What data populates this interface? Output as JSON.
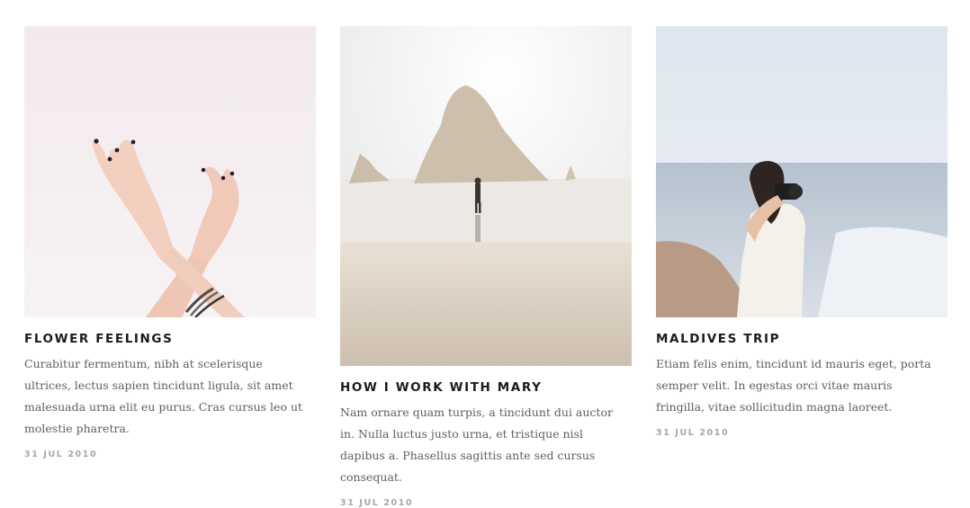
{
  "posts": [
    {
      "title": "Flower Feelings",
      "excerpt": "Curabitur fermentum, nibh at scelerisque ultrices, lectus sapien tincidunt ligula, sit amet malesuada urna elit eu purus. Cras cursus leo ut molestie pharetra.",
      "date": "31 Jul 2010",
      "image": "crossed-hands-photo"
    },
    {
      "title": "How I Work With Mary",
      "excerpt": "Nam ornare quam turpis, a tincidunt dui auctor in. Nulla luctus justo urna, et tristique nisl dapibus a. Phasellus sagittis ante sed cursus consequat.",
      "date": "31 Jul 2010",
      "image": "beach-rock-person-photo"
    },
    {
      "title": "Maldives Trip",
      "excerpt": "Etiam felis enim, tincidunt id mauris eget, porta semper velit. In egestas orci vitae mauris fringilla, vitae sollicitudin magna laoreet.",
      "date": "31 Jul 2010",
      "image": "woman-camera-beach-photo"
    }
  ],
  "colors": {
    "title": "#1b1b1b",
    "body": "#5e5e5e",
    "meta": "#a7a7a7",
    "background": "#ffffff"
  }
}
